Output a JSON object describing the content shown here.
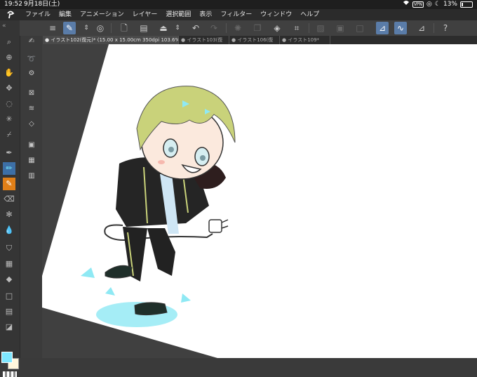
{
  "status": {
    "time": "19:52",
    "date": "9月18日(土)",
    "battery": "13%"
  },
  "menu": [
    "ファイル",
    "編集",
    "アニメーション",
    "レイヤー",
    "選択範囲",
    "表示",
    "フィルター",
    "ウィンドウ",
    "ヘルプ"
  ],
  "tabs": [
    "● イラスト102(復元)* (15.00 x 15.00cm 350dpi 103.6%)",
    "● イラスト103(復",
    "● イラスト106(復",
    "● イラスト109*"
  ],
  "colors": {
    "main": "#7ee7ff",
    "sub": "#fff6dc",
    "accent": "#5a7ca8",
    "active_tool": "#e07f18"
  }
}
